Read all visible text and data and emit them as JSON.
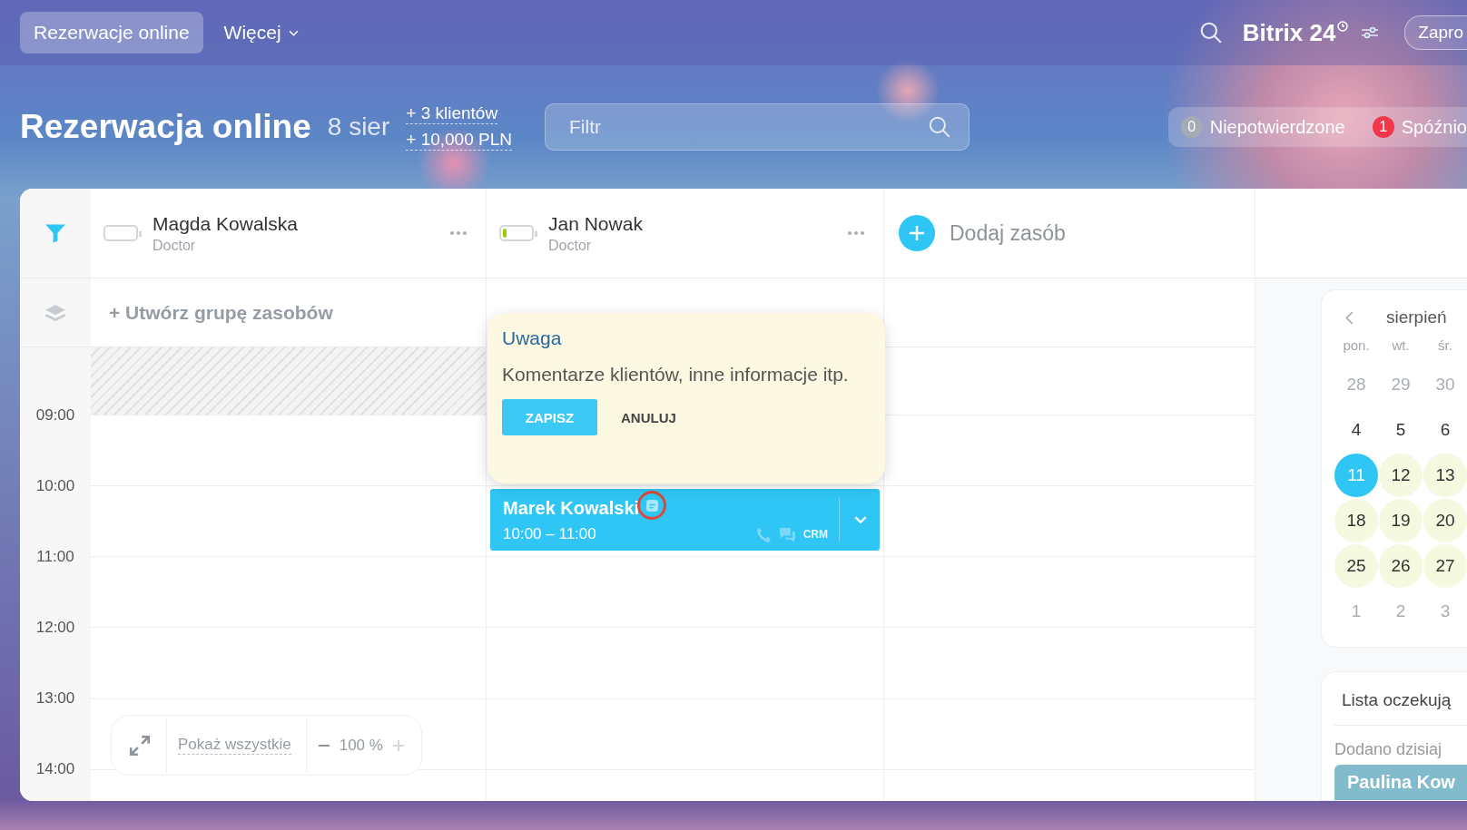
{
  "topbar": {
    "tabs": [
      {
        "label": "Rezerwacje online",
        "selected": true,
        "dropdown": false
      },
      {
        "label": "Więcej",
        "selected": false,
        "dropdown": true
      }
    ],
    "logo": "Bitrix 24",
    "invite_button": "Zapro"
  },
  "header": {
    "title": "Rezerwacja online",
    "date": "8 sier",
    "stats": [
      "+ 3 klientów",
      "+ 10,000 PLN"
    ],
    "filter": {
      "placeholder": "Filtr"
    },
    "counters": [
      {
        "count": "0",
        "label": "Niepotwierdzone",
        "color": "#a3abb5"
      },
      {
        "count": "1",
        "label": "Spóźnio",
        "color": "#f0384a"
      }
    ]
  },
  "resources": [
    {
      "name": "Magda Kowalska",
      "role": "Doctor",
      "level": 0,
      "group_action": "+ Utwórz grupę zasobów",
      "blocked_slot": true
    },
    {
      "name": "Jan Nowak",
      "role": "Doctor",
      "level": 0.12,
      "blocked_slot": false,
      "bookings": [
        {
          "client": "Marek Kowalski",
          "time": "10:00 – 11:00",
          "crm": "CRM",
          "has_note": true
        }
      ]
    }
  ],
  "add_resource": "Dodaj zasób",
  "hours": [
    "09:00",
    "10:00",
    "11:00",
    "12:00",
    "13:00",
    "14:00"
  ],
  "note_popup": {
    "title": "Uwaga",
    "text": "Komentarze klientów, inne informacje itp.",
    "buttons": [
      {
        "label": "ZAPISZ",
        "kind": "primary"
      },
      {
        "label": "ANULUJ",
        "kind": "plain"
      }
    ]
  },
  "zoom": {
    "show_all": "Pokaż wszystkie",
    "value": "100 %"
  },
  "calendar": {
    "month": "sierpień",
    "weekdays": [
      "pon.",
      "wt.",
      "śr."
    ],
    "weeks": [
      [
        {
          "label": "28",
          "kind": "outside",
          "selected": false
        },
        {
          "label": "29",
          "kind": "outside",
          "selected": false
        },
        {
          "label": "30",
          "kind": "outside",
          "selected": false
        }
      ],
      [
        {
          "label": "4",
          "kind": "normal",
          "selected": false
        },
        {
          "label": "5",
          "kind": "normal",
          "selected": false
        },
        {
          "label": "6",
          "kind": "normal",
          "selected": false
        }
      ],
      [
        {
          "label": "11",
          "kind": "free",
          "selected": true
        },
        {
          "label": "12",
          "kind": "free",
          "selected": false
        },
        {
          "label": "13",
          "kind": "free",
          "selected": false
        }
      ],
      [
        {
          "label": "18",
          "kind": "free",
          "selected": false
        },
        {
          "label": "19",
          "kind": "free",
          "selected": false
        },
        {
          "label": "20",
          "kind": "free",
          "selected": false
        }
      ],
      [
        {
          "label": "25",
          "kind": "free",
          "selected": false
        },
        {
          "label": "26",
          "kind": "free",
          "selected": false
        },
        {
          "label": "27",
          "kind": "free",
          "selected": false
        }
      ],
      [
        {
          "label": "1",
          "kind": "outside",
          "selected": false
        },
        {
          "label": "2",
          "kind": "outside",
          "selected": false
        },
        {
          "label": "3",
          "kind": "outside",
          "selected": false
        }
      ]
    ]
  },
  "waiting_list": {
    "title": "Lista oczekują",
    "group": "Dodano dzisiaj",
    "items": [
      "Paulina Kow"
    ]
  }
}
